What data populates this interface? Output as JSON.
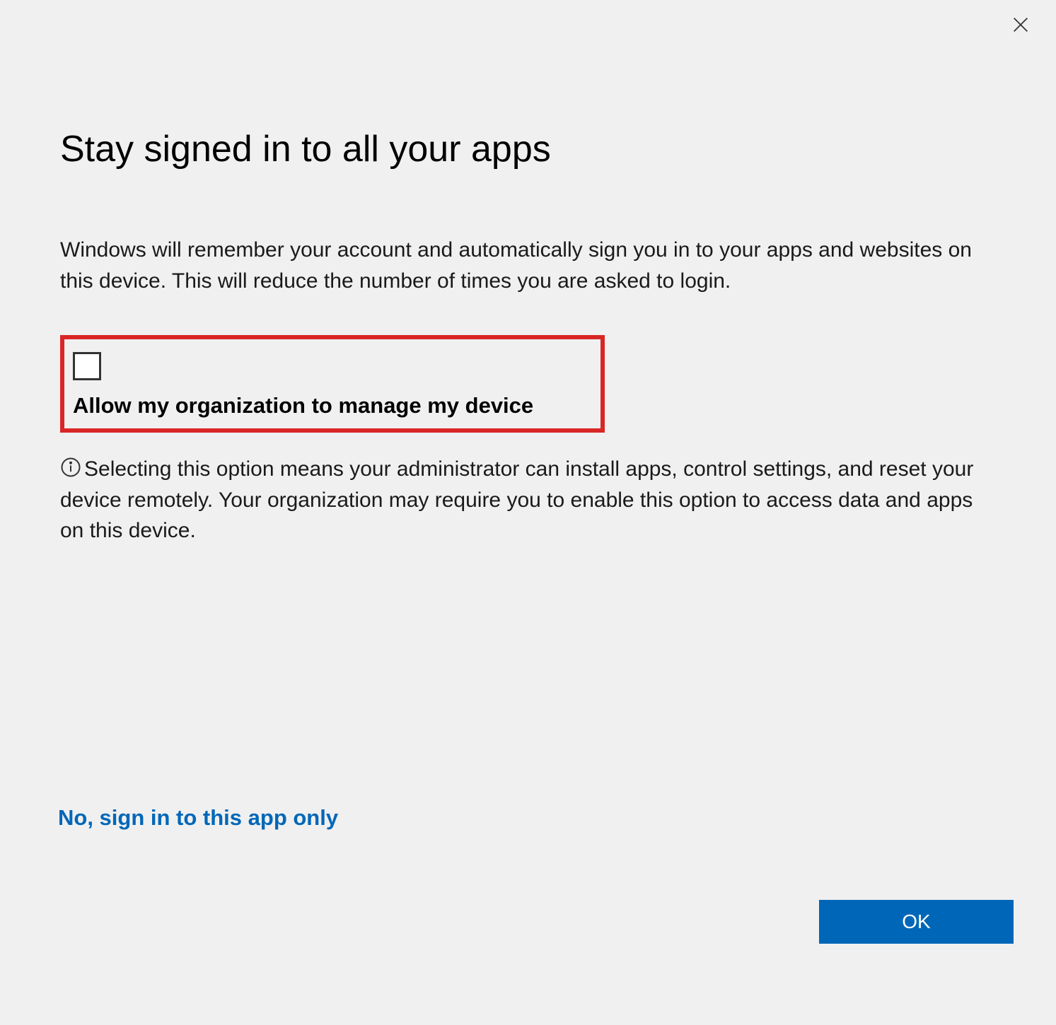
{
  "dialog": {
    "title": "Stay signed in to all your apps",
    "description": "Windows will remember your account and automatically sign you in to your apps and websites on this device. This will reduce the number of times you are asked to login.",
    "checkbox_label": "Allow my organization to manage my device",
    "info_text": "Selecting this option means your administrator can install apps, control settings, and reset your device remotely. Your organization may require you to enable this option to access data and apps on this device.",
    "link_label": "No, sign in to this app only",
    "ok_label": "OK"
  }
}
